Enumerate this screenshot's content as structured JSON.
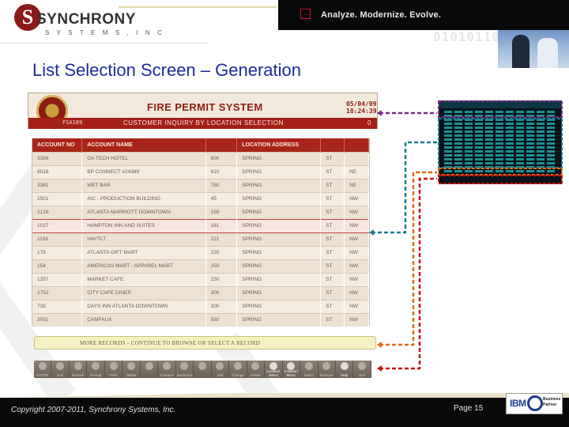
{
  "header": {
    "logo_name": "SYNCHRONY",
    "logo_sub": "S Y S T E M S ,  I N C",
    "tagline": "Analyze. Modernize. Evolve.",
    "binary_deco": "01010110101"
  },
  "slide": {
    "title": "List Selection Screen – Generation"
  },
  "fire_permit": {
    "system_title": "FIRE PERMIT SYSTEM",
    "date": "05/04/09",
    "time": "18:24:39",
    "program_id": "FSA189",
    "subtitle": "CUSTOMER INQUIRY BY LOCATION SELECTION",
    "page_count": "0"
  },
  "table": {
    "columns": [
      "ACCOUNT NO",
      "ACCOUNT NAME",
      "",
      "LOCATION ADDRESS",
      "",
      ""
    ],
    "rows": [
      [
        "3356",
        "GA TECH HOTEL",
        "800",
        "SPRING",
        "ST",
        ""
      ],
      [
        "8518",
        "BP CONNECT #24389",
        "810",
        "SPRING",
        "ST",
        "NE"
      ],
      [
        "3381",
        "WET BAR",
        "760",
        "SPRING",
        "ST",
        "NE"
      ],
      [
        "2501",
        "AIC - PRODUCTION BUILDING",
        "45",
        "SPRING",
        "ST",
        "NW"
      ],
      [
        "2126",
        "ATLANTA MARRIOTT DOWNTOWN",
        "160",
        "SPRING",
        "ST",
        "NW"
      ],
      [
        "1027",
        "HAMPTON INN AND SUITES",
        "161",
        "SPRING",
        "ST",
        "NW"
      ],
      [
        "1158",
        "HAYTLT",
        "221",
        "SPRING",
        "ST",
        "NW"
      ],
      [
        "178",
        "ATLANTA GIFT MART",
        "230",
        "SPRING",
        "ST",
        "NW"
      ],
      [
        "154",
        "AMERICAS MART - APPAREL MART",
        "250",
        "SPRING",
        "ST",
        "NW"
      ],
      [
        "1357",
        "MARKET CAFE",
        "250",
        "SPRING",
        "ST",
        "NW"
      ],
      [
        "2752",
        "CITY CAFE DINER",
        "300",
        "SPRING",
        "ST",
        "NW"
      ],
      [
        "735",
        "DAYS INN ATLANTA DOWNTOWN",
        "300",
        "SPRING",
        "ST",
        "NW"
      ],
      [
        "3051",
        "CAMFAUX",
        "560",
        "SPRING",
        "ST",
        "NW"
      ]
    ]
  },
  "message": "MORE RECORDS - CONTINUE TO BROWSE OR SELECT A RECORD",
  "toolbar": {
    "buttons": [
      "ENTER",
      "Exit",
      "Refresh",
      "Prompt",
      "Print",
      "Delete",
      "",
      "Forward",
      "Backward",
      "",
      "Add",
      "Change",
      "Delete",
      "Location Select",
      "Location Menu",
      "Select",
      "Remove",
      "Help",
      "Exit"
    ]
  },
  "footer": {
    "copyright": "Copyright 2007-2011, Synchrony Systems, Inc.",
    "page": "Page 15",
    "ibm": "IBM",
    "partner_line1": "Business",
    "partner_line2": "Partner"
  },
  "colors": {
    "title_blue": "#1c2a9c",
    "permit_red": "#a41f17",
    "connector_purple": "#7b2a86",
    "connector_teal": "#1b7c8c",
    "connector_orange": "#e36a12",
    "connector_red": "#c81010"
  }
}
